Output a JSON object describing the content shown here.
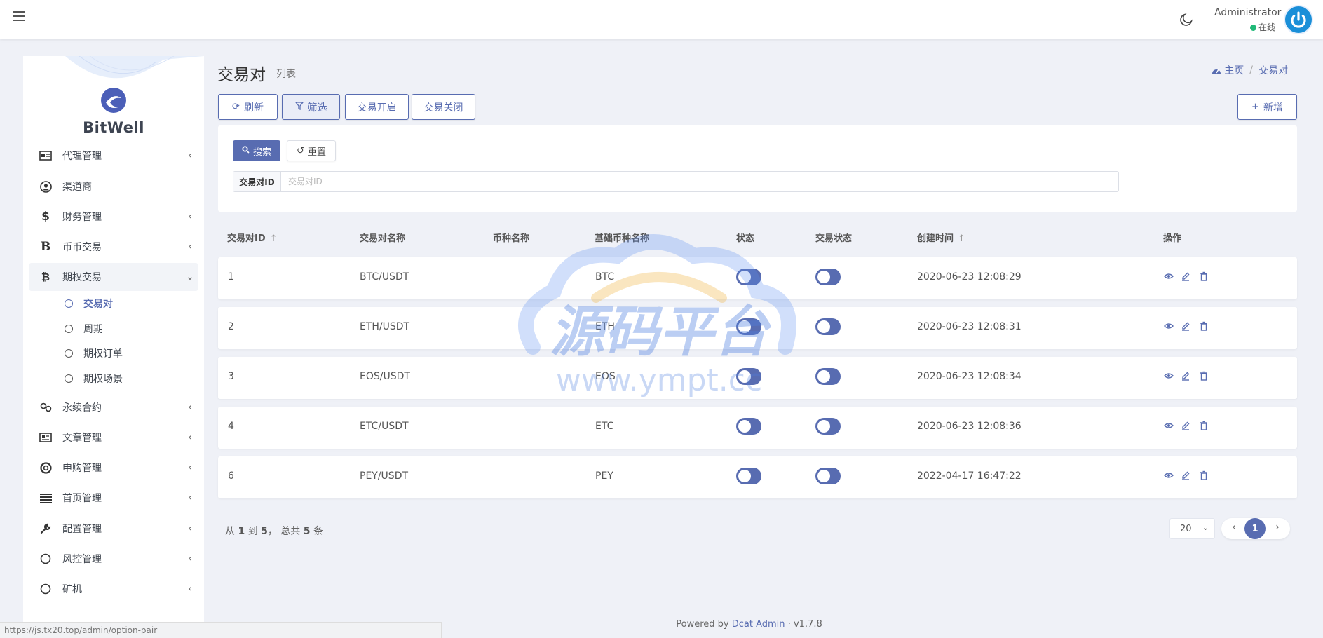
{
  "topbar": {
    "user_name": "Administrator",
    "user_status": "在线"
  },
  "sidebar": {
    "brand": "BitWell",
    "items": [
      {
        "label": "代理管理",
        "icon": "id-card-icon"
      },
      {
        "label": "渠道商",
        "icon": "user-circle-icon"
      },
      {
        "label": "财务管理",
        "icon": "dollar-icon"
      },
      {
        "label": "币币交易",
        "icon": "b-icon"
      },
      {
        "label": "期权交易",
        "icon": "bitcoin-icon"
      },
      {
        "label": "永续合约",
        "icon": "link-icon"
      },
      {
        "label": "文章管理",
        "icon": "newspaper-icon"
      },
      {
        "label": "申购管理",
        "icon": "lifebuoy-icon"
      },
      {
        "label": "首页管理",
        "icon": "list-icon"
      },
      {
        "label": "配置管理",
        "icon": "wrench-icon"
      },
      {
        "label": "风控管理",
        "icon": "circle-icon"
      },
      {
        "label": "矿机",
        "icon": "circle-icon"
      }
    ],
    "sub_items": [
      {
        "label": "交易对"
      },
      {
        "label": "周期"
      },
      {
        "label": "期权订单"
      },
      {
        "label": "期权场景"
      }
    ]
  },
  "header": {
    "title": "交易对",
    "subtitle": "列表",
    "breadcrumb_home": "主页",
    "breadcrumb_current": "交易对"
  },
  "toolbar": {
    "refresh": "刷新",
    "filter": "筛选",
    "trade_open": "交易开启",
    "trade_close": "交易关闭",
    "add": "新增"
  },
  "filter": {
    "search": "搜索",
    "reset": "重置",
    "field_label": "交易对ID",
    "field_placeholder": "交易对ID"
  },
  "table": {
    "columns": [
      "交易对ID",
      "交易对名称",
      "币种名称",
      "基础币种名称",
      "状态",
      "交易状态",
      "创建时间",
      "操作"
    ],
    "rows": [
      {
        "id": "1",
        "name": "BTC/USDT",
        "coin": "",
        "base": "BTC",
        "status": true,
        "trade_status": true,
        "created": "2020-06-23 12:08:29"
      },
      {
        "id": "2",
        "name": "ETH/USDT",
        "coin": "",
        "base": "ETH",
        "status": true,
        "trade_status": true,
        "created": "2020-06-23 12:08:31"
      },
      {
        "id": "3",
        "name": "EOS/USDT",
        "coin": "",
        "base": "EOS",
        "status": true,
        "trade_status": true,
        "created": "2020-06-23 12:08:34"
      },
      {
        "id": "4",
        "name": "ETC/USDT",
        "coin": "",
        "base": "ETC",
        "status": true,
        "trade_status": true,
        "created": "2020-06-23 12:08:36"
      },
      {
        "id": "6",
        "name": "PEY/USDT",
        "coin": "",
        "base": "PEY",
        "status": true,
        "trade_status": true,
        "created": "2022-04-17 16:47:22"
      }
    ]
  },
  "pagination": {
    "from_word": "从",
    "from": "1",
    "to_word": "到",
    "to": "5",
    "total_word": "， 总共",
    "total": "5",
    "unit": "条",
    "per_page": "20",
    "current": "1"
  },
  "footer": {
    "powered_by": "Powered by",
    "link": "Dcat Admin",
    "version": "· v1.7.8"
  },
  "status_url": "https://js.tx20.top/admin/option-pair",
  "watermark": {
    "text_cn": "源码平台",
    "text_url": "www.ympt.cc"
  },
  "colors": {
    "primary": "#586cb1",
    "online": "#21b978",
    "background": "#eff1f7"
  }
}
